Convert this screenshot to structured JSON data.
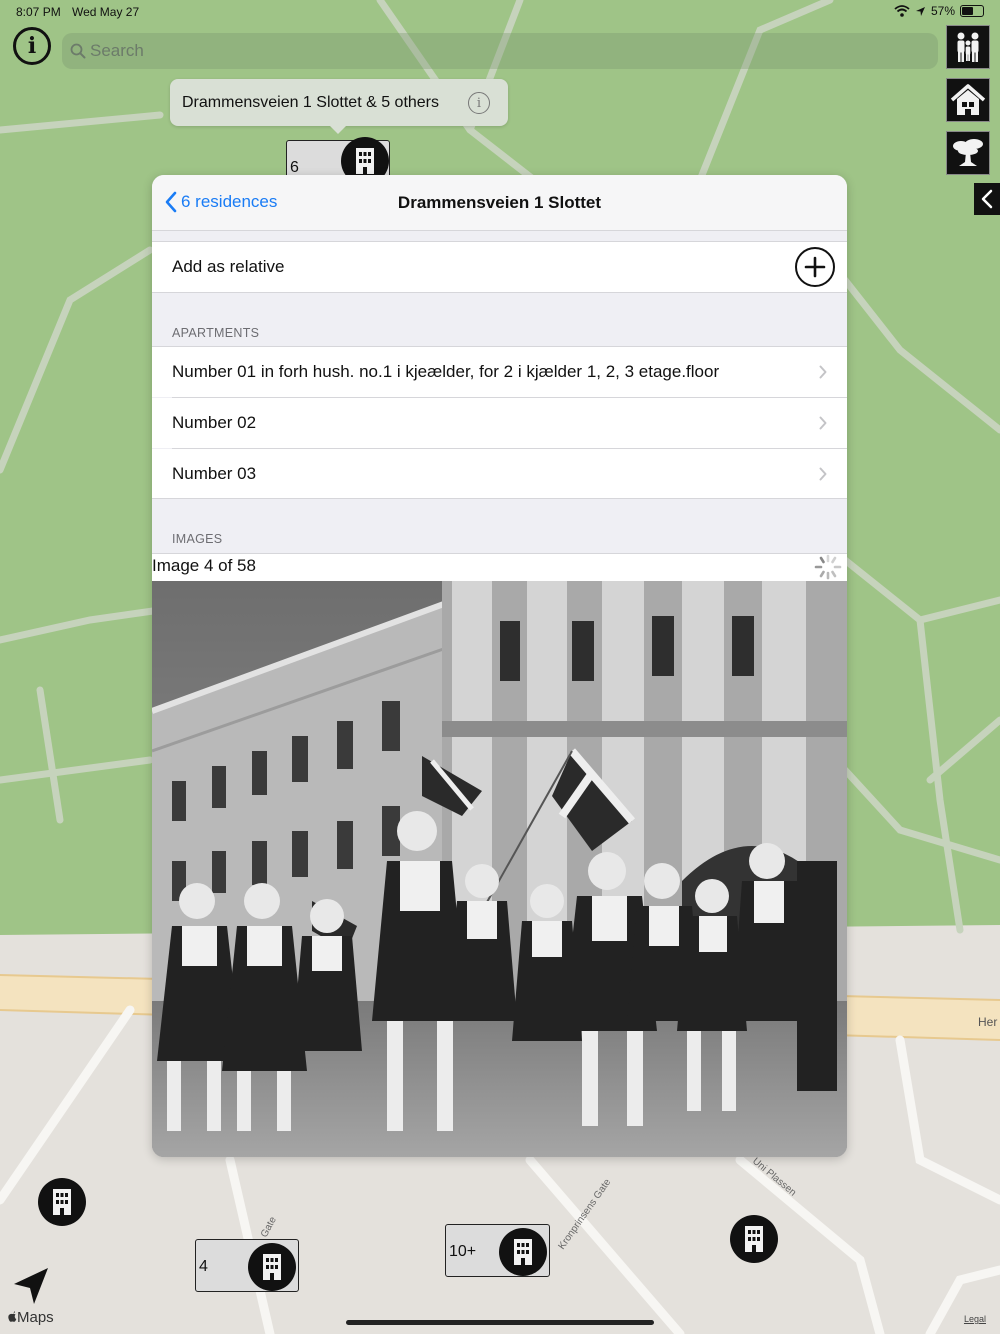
{
  "status_bar": {
    "time": "8:07 PM",
    "date": "Wed May 27",
    "battery_percent": "57%",
    "battery_level": 0.57
  },
  "search": {
    "placeholder": "Search"
  },
  "callout": {
    "text": "Drammensveien 1 Slottet & 5 others",
    "info_icon": "info-icon"
  },
  "map_markers": {
    "top_cluster_count": "6",
    "cluster_a_count": "4",
    "cluster_b_count": "10+"
  },
  "map_labels": {
    "street_1": "Kronprinsens Gate",
    "street_2": "Uni Plassen",
    "street_3": "Gate",
    "street_right": "Her"
  },
  "side_buttons": [
    "family-icon",
    "house-icon",
    "tree-icon"
  ],
  "panel": {
    "back_label": "6 residences",
    "title": "Drammensveien 1 Slottet",
    "add_relative_label": "Add as relative",
    "apartments_header": "APARTMENTS",
    "apartments": [
      "Number 01 in forh hush. no.1 i kjeælder, for 2 i kjælder 1, 2, 3 etage.floor",
      "Number 02",
      "Number 03"
    ],
    "images_header": "IMAGES",
    "image_caption": "Image 4 of 58"
  },
  "bottom": {
    "maps_brand": "Maps",
    "legal": "Legal"
  },
  "colors": {
    "map_green": "#9fc487",
    "link_blue": "#1a7cf5",
    "panel_bg": "#efeff4"
  }
}
